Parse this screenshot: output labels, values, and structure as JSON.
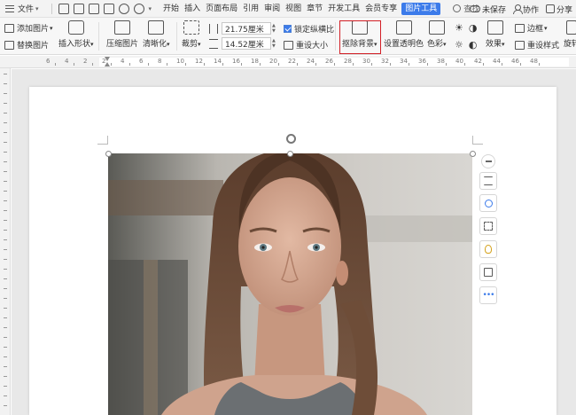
{
  "menu": {
    "file_label": "文件",
    "tabs": [
      "开始",
      "插入",
      "页面布局",
      "引用",
      "审阅",
      "视图",
      "章节",
      "开发工具",
      "会员专享",
      "图片工具"
    ],
    "active_tab": "图片工具",
    "search_label": "查找"
  },
  "rightbar": {
    "unsaved": "未保存",
    "collab": "协作",
    "share": "分享"
  },
  "ribbon": {
    "add_picture": "添加图片",
    "replace_picture": "替换图片",
    "insert_shape": "插入形状",
    "compress_picture": "压缩图片",
    "sharpen": "清晰化",
    "crop": "裁剪",
    "width_value": "21.75厘米",
    "height_value": "14.52厘米",
    "lock_ratio": "锁定纵横比",
    "reset_size": "重设大小",
    "remove_background": "抠除背景",
    "set_transparent": "设置透明色",
    "color": "色彩",
    "effects": "效果",
    "border": "边框",
    "reset_style": "重设样式",
    "rotate": "旋转"
  },
  "ruler": {
    "h_numbers": [
      "6",
      "4",
      "2",
      "2",
      "4",
      "6",
      "8",
      "10",
      "12",
      "14",
      "16",
      "18",
      "20",
      "22",
      "24",
      "26",
      "28",
      "30",
      "32",
      "34",
      "36",
      "38",
      "40",
      "42",
      "44",
      "46",
      "48"
    ]
  },
  "colors": {
    "accent": "#3c7bea",
    "highlight_border": "#d21f26"
  },
  "side_tools": [
    "collapse-icon",
    "text-wrap-icon",
    "zoom-icon",
    "crop-icon",
    "idea-icon",
    "picture-icon",
    "more-icon"
  ]
}
